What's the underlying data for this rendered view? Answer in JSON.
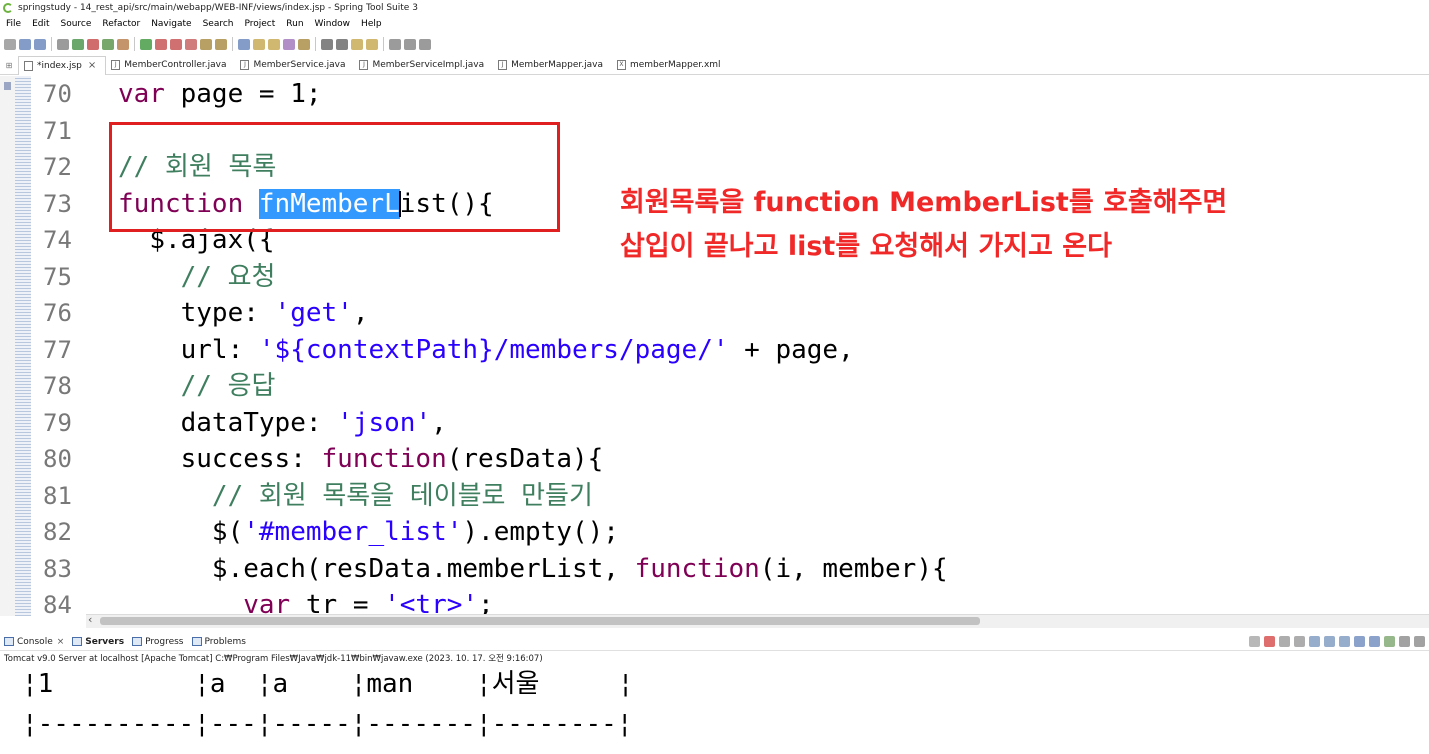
{
  "window": {
    "title": "springstudy - 14_rest_api/src/main/webapp/WEB-INF/views/index.jsp - Spring Tool Suite 3"
  },
  "menu": [
    "File",
    "Edit",
    "Source",
    "Refactor",
    "Navigate",
    "Search",
    "Project",
    "Run",
    "Window",
    "Help"
  ],
  "tabs": [
    {
      "label": "*index.jsp",
      "icon": "jsp-file-icon",
      "active": true
    },
    {
      "label": "MemberController.java",
      "icon": "java-file-icon"
    },
    {
      "label": "MemberService.java",
      "icon": "java-file-icon"
    },
    {
      "label": "MemberServiceImpl.java",
      "icon": "java-file-icon"
    },
    {
      "label": "MemberMapper.java",
      "icon": "java-file-icon"
    },
    {
      "label": "memberMapper.xml",
      "icon": "xml-file-icon"
    }
  ],
  "code": {
    "lines": [
      {
        "n": "70",
        "indent": "",
        "tokens": [
          {
            "t": "kw",
            "v": "var"
          },
          {
            "t": "plain",
            "v": " page = 1;"
          }
        ]
      },
      {
        "n": "71",
        "indent": "",
        "tokens": []
      },
      {
        "n": "72",
        "indent": "",
        "tokens": [
          {
            "t": "cmt",
            "v": "// 회원 목록"
          }
        ]
      },
      {
        "n": "73",
        "indent": "",
        "tokens": [
          {
            "t": "kw",
            "v": "function"
          },
          {
            "t": "plain",
            "v": " "
          },
          {
            "t": "sel",
            "v": "fnMemberL"
          },
          {
            "t": "cursor",
            "v": ""
          },
          {
            "t": "plain",
            "v": "ist(){"
          }
        ]
      },
      {
        "n": "74",
        "indent": "  ",
        "tokens": [
          {
            "t": "plain",
            "v": "$.ajax({"
          }
        ]
      },
      {
        "n": "75",
        "indent": "    ",
        "tokens": [
          {
            "t": "cmt",
            "v": "// 요청"
          }
        ]
      },
      {
        "n": "76",
        "indent": "    ",
        "tokens": [
          {
            "t": "plain",
            "v": "type: "
          },
          {
            "t": "str",
            "v": "'get'"
          },
          {
            "t": "plain",
            "v": ","
          }
        ]
      },
      {
        "n": "77",
        "indent": "    ",
        "tokens": [
          {
            "t": "plain",
            "v": "url: "
          },
          {
            "t": "str",
            "v": "'${contextPath}/members/page/'"
          },
          {
            "t": "plain",
            "v": " + page,"
          }
        ]
      },
      {
        "n": "78",
        "indent": "    ",
        "tokens": [
          {
            "t": "cmt",
            "v": "// 응답"
          }
        ]
      },
      {
        "n": "79",
        "indent": "    ",
        "tokens": [
          {
            "t": "plain",
            "v": "dataType: "
          },
          {
            "t": "str",
            "v": "'json'"
          },
          {
            "t": "plain",
            "v": ","
          }
        ]
      },
      {
        "n": "80",
        "indent": "    ",
        "tokens": [
          {
            "t": "plain",
            "v": "success: "
          },
          {
            "t": "kw",
            "v": "function"
          },
          {
            "t": "plain",
            "v": "(resData){"
          }
        ]
      },
      {
        "n": "81",
        "indent": "      ",
        "tokens": [
          {
            "t": "cmt",
            "v": "// 회원 목록을 테이블로 만들기"
          }
        ]
      },
      {
        "n": "82",
        "indent": "      ",
        "tokens": [
          {
            "t": "plain",
            "v": "$("
          },
          {
            "t": "str",
            "v": "'#member_list'"
          },
          {
            "t": "plain",
            "v": ").empty();"
          }
        ]
      },
      {
        "n": "83",
        "indent": "      ",
        "tokens": [
          {
            "t": "plain",
            "v": "$.each(resData.memberList, "
          },
          {
            "t": "kw",
            "v": "function"
          },
          {
            "t": "plain",
            "v": "(i, member){"
          }
        ]
      },
      {
        "n": "84",
        "indent": "        ",
        "tokens": [
          {
            "t": "kw",
            "v": "var"
          },
          {
            "t": "plain",
            "v": " tr = "
          },
          {
            "t": "str",
            "v": "'<tr>'"
          },
          {
            "t": "plain",
            "v": ";"
          }
        ]
      }
    ]
  },
  "annotation": {
    "line1": "회원목록을 function MemberList를 호출해주면",
    "line2": "삽입이 끝나고 list를 요청해서 가지고 온다",
    "color": "#f02828"
  },
  "console": {
    "tabs": [
      {
        "label": "Console",
        "icon": "console-icon"
      },
      {
        "label": "Servers",
        "icon": "servers-icon",
        "bold": true
      },
      {
        "label": "Progress",
        "icon": "progress-icon"
      },
      {
        "label": "Problems",
        "icon": "problems-icon"
      }
    ],
    "info": "Tomcat v9.0 Server at localhost [Apache Tomcat] C:₩Program Files₩Java₩jdk-11₩bin₩javaw.exe  (2023. 10. 17. 오전 9:16:07)",
    "output": [
      "¦1         ¦a  ¦a    ¦man    ¦서울     ¦",
      "¦----------¦---¦-----¦-------¦--------¦"
    ]
  }
}
